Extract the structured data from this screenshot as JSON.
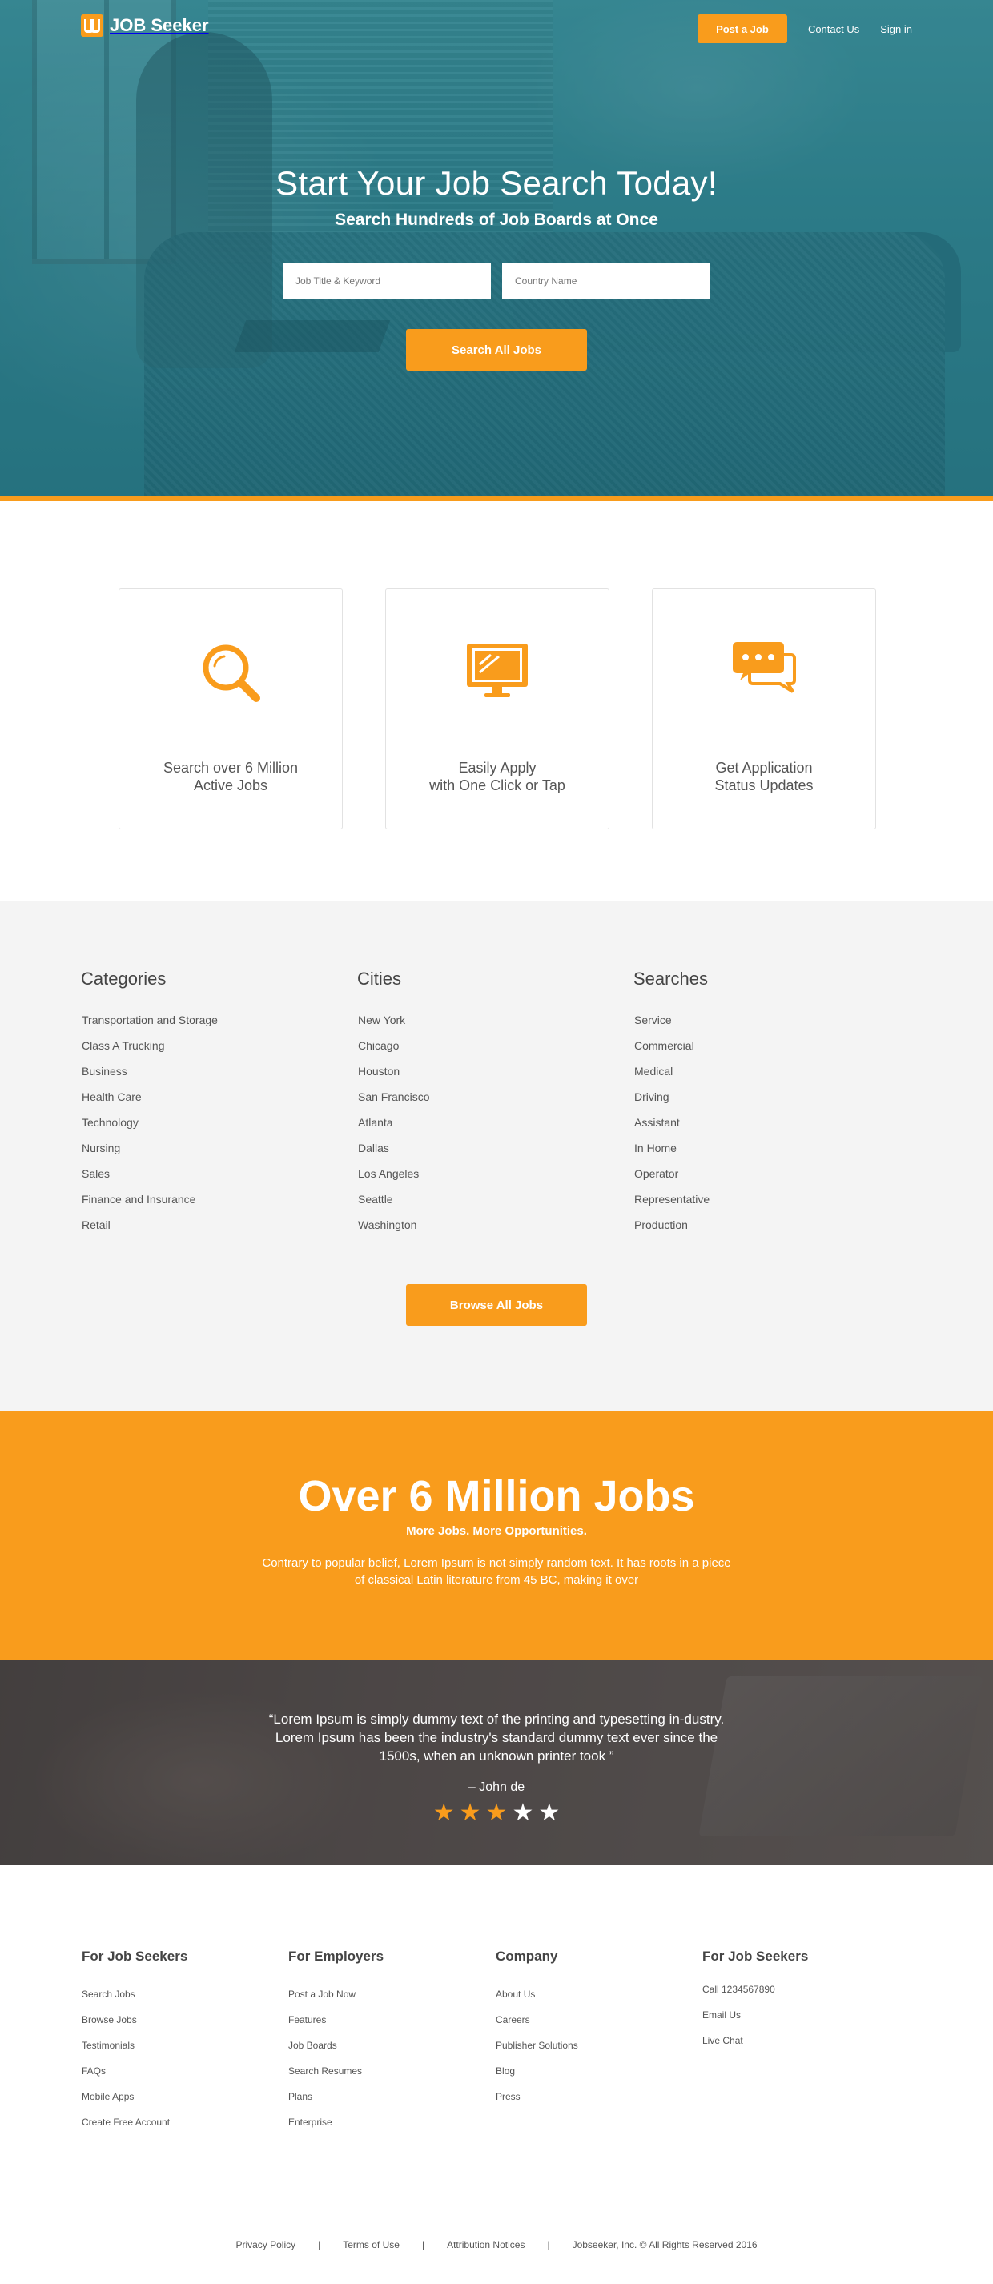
{
  "brand": {
    "name": "JOB Seeker",
    "accent": "#f99c1c",
    "hero_color": "#2f7d8a"
  },
  "nav": {
    "post_job": "Post a Job",
    "contact": "Contact Us",
    "signin": "Sign in"
  },
  "hero": {
    "title": "Start Your Job Search Today!",
    "subtitle": "Search Hundreds of Job Boards at Once",
    "keyword_placeholder": "Job Title & Keyword",
    "country_placeholder": "Country Name",
    "search_button": "Search All Jobs"
  },
  "features": [
    {
      "icon": "search-icon",
      "line1": "Search over 6 Million",
      "line2": "Active Jobs"
    },
    {
      "icon": "monitor-icon",
      "line1": "Easily Apply",
      "line2": "with One Click or Tap"
    },
    {
      "icon": "chat-icon",
      "line1": "Get Application",
      "line2": "Status Updates"
    }
  ],
  "categories": {
    "title": "Categories",
    "items": [
      "Transportation and Storage",
      "Class A Trucking",
      "Business",
      "Health Care",
      "Technology",
      "Nursing",
      "Sales",
      "Finance and Insurance",
      "Retail"
    ]
  },
  "cities": {
    "title": "Cities",
    "items": [
      "New York",
      "Chicago",
      "Houston",
      "San Francisco",
      "Atlanta",
      "Dallas",
      "Los Angeles",
      "Seattle",
      "Washington"
    ]
  },
  "searches": {
    "title": "Searches",
    "items": [
      "Service",
      "Commercial",
      "Medical",
      "Driving",
      "Assistant",
      "In Home",
      "Operator",
      "Representative",
      "Production"
    ]
  },
  "browse_button": "Browse All Jobs",
  "stats": {
    "title": "Over 6 Million Jobs",
    "subtitle": "More Jobs. More Opportunities.",
    "body": "Contrary to popular belief, Lorem Ipsum is not simply random text. It has roots in a piece of classical Latin literature from 45 BC, making it over"
  },
  "testimonial": {
    "quote": "“Lorem Ipsum is simply dummy text of the printing and typesetting in-dustry. Lorem Ipsum has been the industry's standard dummy text ever since the 1500s, when an unknown printer took ”",
    "author": "– John de",
    "rating": 3,
    "max_rating": 5,
    "star_on_color": "#f99c1c",
    "star_off_color": "#ffffff"
  },
  "footer": {
    "seekers": {
      "title": "For Job Seekers",
      "items": [
        "Search Jobs",
        "Browse Jobs",
        "Testimonials",
        "FAQs",
        "Mobile Apps",
        "Create Free Account"
      ]
    },
    "employers": {
      "title": "For Employers",
      "items": [
        "Post a Job Now",
        "Features",
        "Job Boards",
        "Search Resumes",
        "Plans",
        "Enterprise"
      ]
    },
    "company": {
      "title": "Company",
      "items": [
        "About Us",
        "Careers",
        "Publisher Solutions",
        "Blog",
        "Press"
      ]
    },
    "contact": {
      "title": "For Job Seekers",
      "items": [
        "Call 1234567890",
        "Email Us",
        "Live Chat"
      ]
    }
  },
  "legal": {
    "privacy": "Privacy Policy",
    "terms": "Terms of Use",
    "attribution": "Attribution Notices",
    "copyright": "Jobseeker, Inc. © All Rights Reserved 2016",
    "separator": "|"
  }
}
